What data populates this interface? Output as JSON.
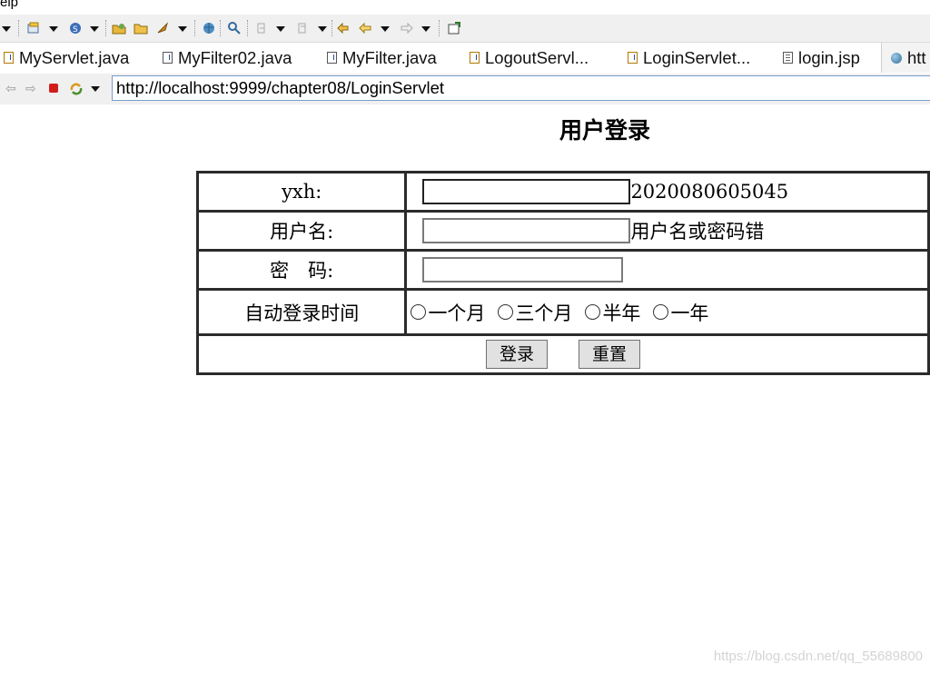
{
  "menu": {
    "fragment": "elp"
  },
  "toolbar": {
    "icons": [
      "dropdown-arrow",
      "new-wizard-icon",
      "spring-icon",
      "open-type-icon",
      "open-folder-icon",
      "run-icon",
      "web-browser-icon",
      "search-icon",
      "next-annotation-icon",
      "prev-annotation-icon",
      "last-edit-icon",
      "back-icon",
      "forward-icon",
      "pin-editor-icon"
    ]
  },
  "tabs": [
    {
      "label": "MyServlet.java",
      "type": "java"
    },
    {
      "label": "MyFilter02.java",
      "type": "java"
    },
    {
      "label": "MyFilter.java",
      "type": "java"
    },
    {
      "label": "LogoutServl...",
      "type": "java"
    },
    {
      "label": "LoginServlet...",
      "type": "java"
    },
    {
      "label": "login.jsp",
      "type": "jsp"
    },
    {
      "label": "htt",
      "type": "browser"
    }
  ],
  "browser": {
    "url": "http://localhost:9999/chapter08/LoginServlet"
  },
  "page": {
    "title": "用户登录",
    "rows": {
      "yxh_label": "yxh:",
      "yxh_value": "",
      "yxh_after": "2020080605045",
      "username_label": "用户名:",
      "username_value": "",
      "username_error": "用户名或密码错",
      "password_label": "密　码:",
      "password_value": "",
      "autologin_label": "自动登录时间",
      "autologin_options": [
        "一个月",
        "三个月",
        "半年",
        "一年"
      ]
    },
    "buttons": {
      "login": "登录",
      "reset": "重置"
    }
  },
  "watermark": "https://blog.csdn.net/qq_55689800"
}
